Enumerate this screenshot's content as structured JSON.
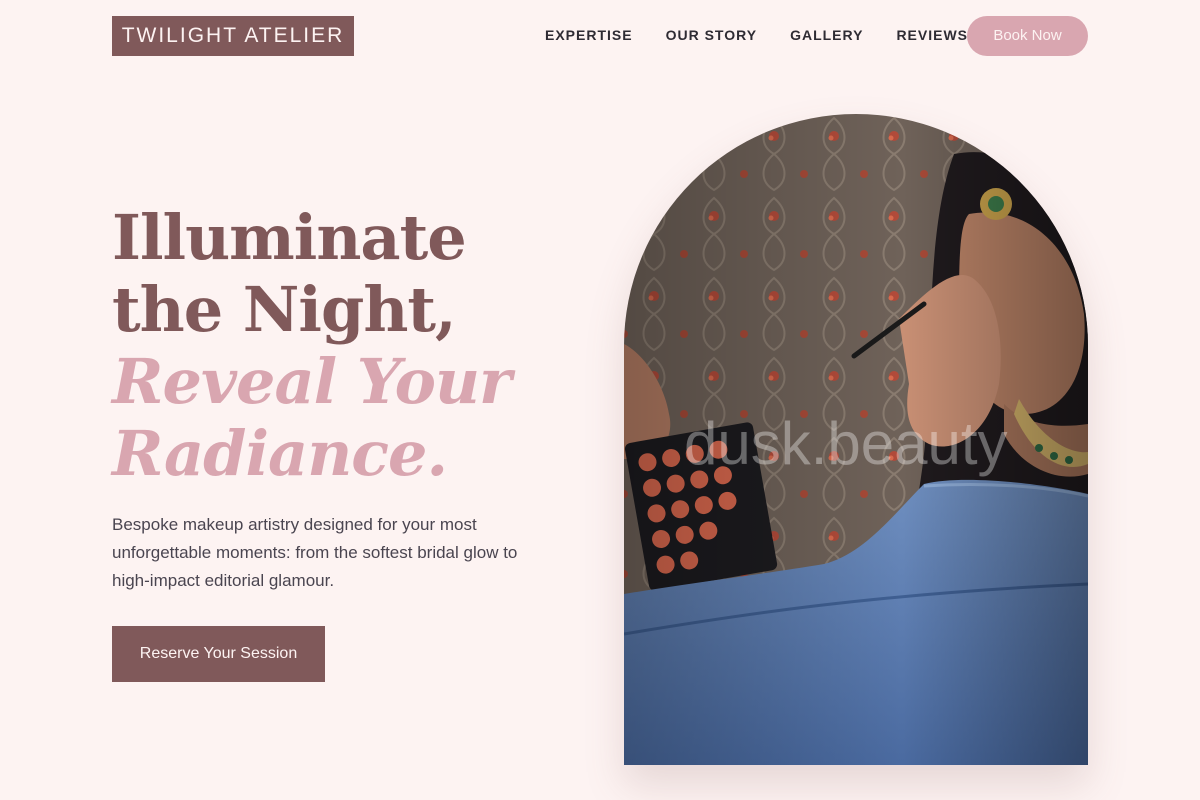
{
  "header": {
    "logo": "TWILIGHT ATELIER",
    "nav": [
      {
        "label": "EXPERTISE"
      },
      {
        "label": "OUR STORY"
      },
      {
        "label": "GALLERY"
      },
      {
        "label": "REVIEWS"
      }
    ],
    "book_label": "Book Now"
  },
  "hero": {
    "title_line1": "Illuminate",
    "title_line2": "the Night,",
    "title_line3": "Reveal Your",
    "title_line4": "Radiance.",
    "description": "Bespoke makeup artistry designed for your most unforgettable moments: from the softest bridal glow to high-impact editorial glamour.",
    "cta_label": "Reserve Your Session",
    "image_watermark": "dusk.beauty"
  },
  "colors": {
    "background": "#fdf3f2",
    "primary": "#80595a",
    "accent": "#d9a6b0",
    "text": "#2e2b33"
  }
}
